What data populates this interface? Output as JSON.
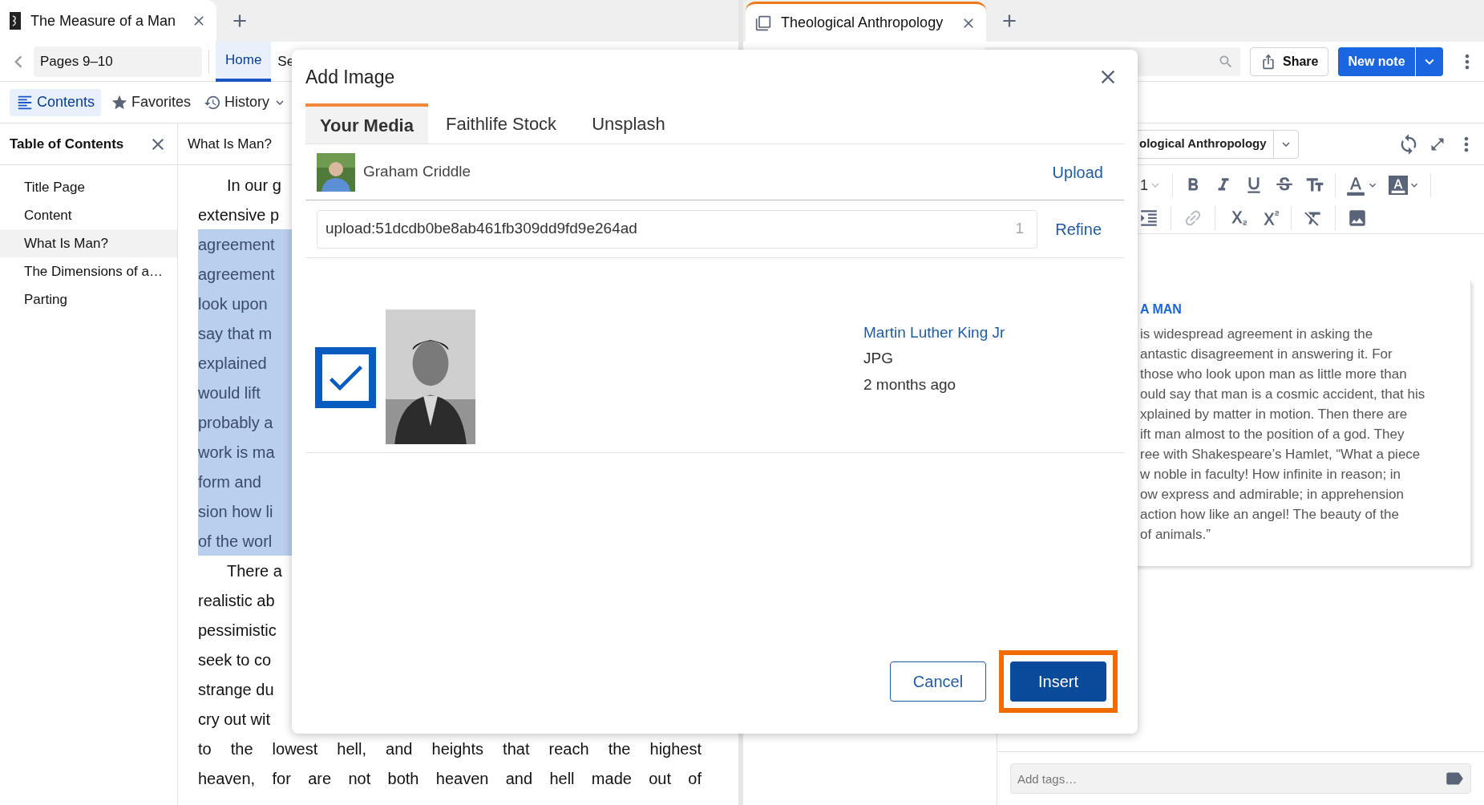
{
  "left_pane": {
    "tab": {
      "title": "The Measure of a Man"
    },
    "location": "Pages 9–10",
    "nav_tabs": [
      {
        "label": "Home",
        "selected": true
      },
      {
        "label": "Se",
        "selected": false
      }
    ],
    "toolbar": [
      {
        "label": "Contents",
        "selected": true,
        "kind": "contents"
      },
      {
        "label": "Favorites",
        "selected": false,
        "kind": "favorites"
      },
      {
        "label": "History",
        "selected": false,
        "kind": "history"
      }
    ],
    "toc": {
      "title": "Table of Contents",
      "items": [
        {
          "label": "Title Page",
          "selected": false
        },
        {
          "label": "Content",
          "selected": false
        },
        {
          "label": "What Is Man?",
          "selected": true
        },
        {
          "label": "The Dimensions of a…",
          "selected": false
        },
        {
          "label": "Parting",
          "selected": false
        }
      ]
    },
    "reader": {
      "title": "What Is Man?",
      "lines": [
        {
          "text": "In our g",
          "indent": true,
          "highlighted": false
        },
        {
          "text": "extensive p",
          "indent": false,
          "highlighted": false
        },
        {
          "text": "agreement",
          "indent": false,
          "highlighted": true
        },
        {
          "text": "agreement",
          "indent": false,
          "highlighted": true
        },
        {
          "text": "look upon",
          "indent": false,
          "highlighted": true
        },
        {
          "text": "say that m",
          "indent": false,
          "highlighted": true
        },
        {
          "text": "explained",
          "indent": false,
          "highlighted": true
        },
        {
          "text": "would lift",
          "indent": false,
          "highlighted": true
        },
        {
          "text": "probably a",
          "indent": false,
          "highlighted": true
        },
        {
          "text": "work is ma",
          "indent": false,
          "highlighted": true
        },
        {
          "text": "form and",
          "indent": false,
          "highlighted": true
        },
        {
          "text": "sion how li",
          "indent": false,
          "highlighted": true
        },
        {
          "text": "of the worl",
          "indent": false,
          "highlighted": true
        },
        {
          "text": "There a",
          "indent": true,
          "highlighted": false
        },
        {
          "text": "realistic ab",
          "indent": false,
          "highlighted": false
        },
        {
          "text": "pessimistic",
          "indent": false,
          "highlighted": false
        },
        {
          "text": "seek to co",
          "indent": false,
          "highlighted": false
        },
        {
          "text": "strange du",
          "indent": false,
          "highlighted": false
        },
        {
          "text": "cry out wit",
          "indent": false,
          "highlighted": false
        },
        {
          "text": "to the lowest hell, and heights that reach the highest",
          "indent": false,
          "highlighted": false
        },
        {
          "text": "heaven, for are not both heaven and hell made out of",
          "indent": false,
          "highlighted": false
        }
      ]
    }
  },
  "right_pane": {
    "tab": {
      "title": "Theological Anthropology"
    },
    "share": "Share",
    "new_note": "New note",
    "notebook": "ological Anthropology",
    "font_size": "1",
    "note": {
      "heading": "A MAN",
      "lines": [
        "is widespread agreement in asking the",
        "antastic disagreement in answering it. For",
        "those who look upon man as little more than",
        "ould say that man is a cosmic accident, that his",
        "xplained by matter in motion. Then there are",
        "ift man almost to the position of a god. They",
        "ree with Shakespeare’s Hamlet, “What a piece",
        "w noble in faculty! How infinite in reason; in",
        "ow express and admirable; in apprehension",
        "action how like an angel! The beauty of the",
        "of animals.”"
      ]
    },
    "tags": {
      "placeholder": "Add tags…"
    }
  },
  "dialog": {
    "title": "Add Image",
    "tabs": [
      {
        "label": "Your Media",
        "selected": true
      },
      {
        "label": "Faithlife Stock",
        "selected": false
      },
      {
        "label": "Unsplash",
        "selected": false
      }
    ],
    "user": "Graham Criddle",
    "upload": "Upload",
    "search": {
      "value": "upload:51dcdb0be8ab461fb309dd9fd9e264ad",
      "count": "1"
    },
    "refine": "Refine",
    "items": [
      {
        "checked": true,
        "title": "Martin Luther King Jr",
        "type": "JPG",
        "age": "2 months ago"
      }
    ],
    "cancel": "Cancel",
    "insert": {
      "label": "Insert",
      "highlighted": true
    }
  }
}
